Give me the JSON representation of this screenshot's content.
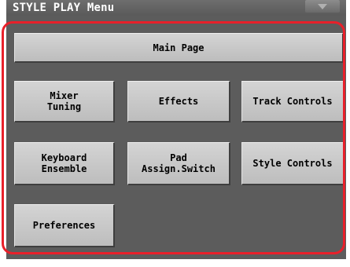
{
  "window": {
    "title": "STYLE PLAY Menu"
  },
  "menu": {
    "main_page": "Main Page",
    "mixer_tuning": "Mixer\nTuning",
    "effects": "Effects",
    "track_controls": "Track Controls",
    "keyboard_ensemble": "Keyboard\nEnsemble",
    "pad_assign_switch": "Pad\nAssign.Switch",
    "style_controls": "Style Controls",
    "preferences": "Preferences"
  },
  "colors": {
    "panel_background": "#5c5c5c",
    "button_face": "#c9c9c9",
    "highlight_outline": "#e8202a"
  },
  "icons": {
    "menu_arrow": "triangle-down-icon"
  }
}
